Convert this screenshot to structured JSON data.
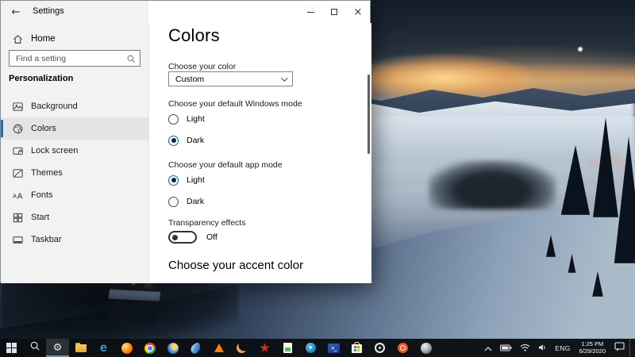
{
  "window": {
    "title": "Settings",
    "controls": [
      "minimize-icon",
      "maximize-icon",
      "close-icon"
    ],
    "close_glyph": "×"
  },
  "sidebar": {
    "home": "Home",
    "home_icon": "home-icon",
    "search_placeholder": "Find a setting",
    "search_icon": "search-icon",
    "section": "Personalization",
    "items": [
      {
        "label": "Background",
        "icon": "image-icon",
        "selected": false
      },
      {
        "label": "Colors",
        "icon": "palette-icon",
        "selected": true
      },
      {
        "label": "Lock screen",
        "icon": "lock-screen-icon",
        "selected": false
      },
      {
        "label": "Themes",
        "icon": "themes-icon",
        "selected": false
      },
      {
        "label": "Fonts",
        "icon": "fonts-icon",
        "selected": false
      },
      {
        "label": "Start",
        "icon": "start-menu-icon",
        "selected": false
      },
      {
        "label": "Taskbar",
        "icon": "taskbar-icon",
        "selected": false
      }
    ]
  },
  "main": {
    "title": "Colors",
    "choose_color_label": "Choose your color",
    "choose_color_value": "Custom",
    "windows_mode_label": "Choose your default Windows mode",
    "windows_mode_options": [
      {
        "label": "Light",
        "selected": false
      },
      {
        "label": "Dark",
        "selected": true
      }
    ],
    "app_mode_label": "Choose your default app mode",
    "app_mode_options": [
      {
        "label": "Light",
        "selected": true
      },
      {
        "label": "Dark",
        "selected": false
      }
    ],
    "transparency_label": "Transparency effects",
    "transparency_state": "Off",
    "accent_heading": "Choose your accent color"
  },
  "taskbar": {
    "apps": [
      "start",
      "search",
      "settings",
      "file-explorer",
      "edge",
      "firefox",
      "chrome",
      "globe-browser",
      "comet-app",
      "vlc",
      "crescent-browser",
      "red-star-app",
      "image-viewer",
      "media-player",
      "powershell",
      "microsoft-store",
      "record-app",
      "ubuntu",
      "gray-sphere-app"
    ],
    "active_app": "settings",
    "tray": {
      "language": "ENG",
      "time": "1:25 PM",
      "date": "6/29/2020",
      "icons": [
        "chevron-up-icon",
        "battery-icon",
        "wifi-icon",
        "volume-icon",
        "action-center-icon"
      ]
    }
  },
  "colors": {
    "accent": "#0078d7",
    "sidebar_bg": "#f2f2f2",
    "taskbar_bg": "#0b0f14",
    "radio_checked_ring": "#0067b8"
  }
}
